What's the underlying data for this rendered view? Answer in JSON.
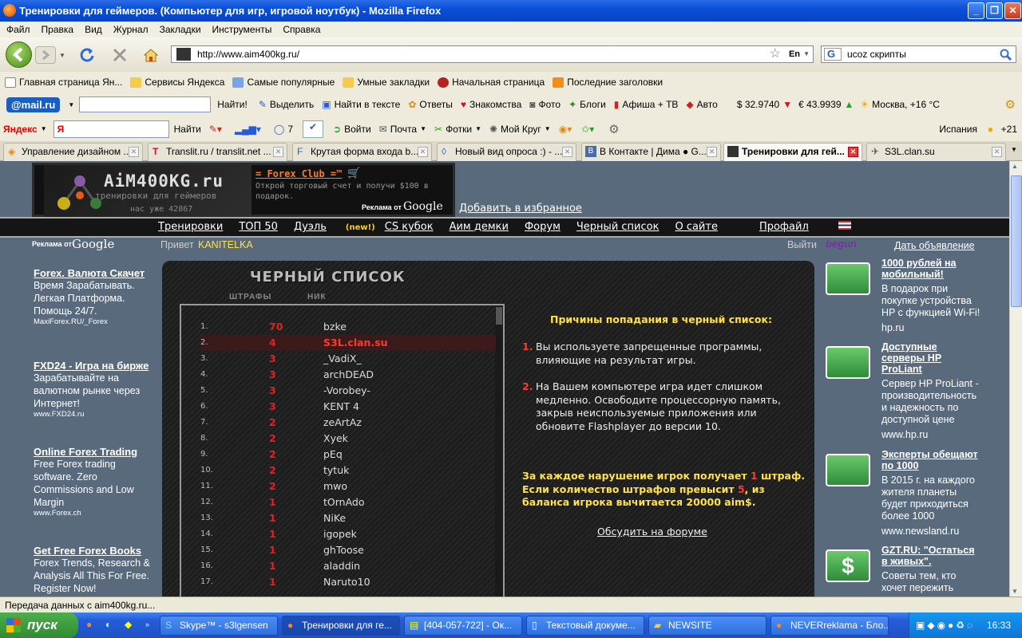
{
  "window": {
    "title": "Тренировки для геймеров. (Компьютер для игр, игровой ноутбук) - Mozilla Firefox"
  },
  "menu": [
    "Файл",
    "Правка",
    "Вид",
    "Журнал",
    "Закладки",
    "Инструменты",
    "Справка"
  ],
  "nav": {
    "url": "http://www.aim400kg.ru/",
    "lang": "En",
    "search_value": "ucoz скрипты"
  },
  "bookmarks": [
    "Главная страница Ян...",
    "Сервисы Яндекса",
    "Самые популярные",
    "Умные закладки",
    "Начальная страница",
    "Последние заголовки"
  ],
  "mailbar": {
    "brand": "@mail.ru",
    "find_btn": "Найти!",
    "items": [
      "Выделить",
      "Найти в тексте",
      "Ответы",
      "Знакомства",
      "Фото",
      "Блоги",
      "Афиша + ТВ",
      "Авто"
    ],
    "usd": "$ 32.9740",
    "eur": "€ 43.9939",
    "weather": "Москва, +16 °C"
  },
  "yandexbar": {
    "brand": "Яндекс",
    "find_btn": "Найти",
    "count": "7",
    "items": [
      "Войти",
      "Почта",
      "Фотки",
      "Мой Круг"
    ],
    "region": "Испания",
    "temp": "+21"
  },
  "tabs": [
    {
      "label": "Управление дизайном ...",
      "active": false
    },
    {
      "label": "Translit.ru / translit.net ...",
      "active": false
    },
    {
      "label": "Крутая форма входа b...",
      "active": false
    },
    {
      "label": "Новый вид опроса :) - ...",
      "active": false
    },
    {
      "label": "В Контакте | Дима ● G...",
      "active": false
    },
    {
      "label": "Тренировки для гей...",
      "active": true
    },
    {
      "label": "S3L.clan.su",
      "active": false
    }
  ],
  "site": {
    "logo_text": "AiM400KG.ru",
    "logo_sub": "тренировки для геймеров",
    "logo_count": "нас уже 42867",
    "banner_title": "= Forex Club =™",
    "banner_text": "Открой торговый счет и получи $100 в подарок.",
    "ads_by": "Реклама от",
    "google": "Google",
    "add_fav": "Добавить в избранное",
    "navlinks": [
      "Тренировки",
      "ТОП 50",
      "Дуэль",
      "CS кубок",
      "Аим демки",
      "Форум",
      "Черный список",
      "О сайте",
      "Профайл"
    ],
    "new_badge": "(new!)",
    "hello": "Привет",
    "user": "KANITELKA",
    "logout": "Выйти",
    "begun": "begun",
    "post_ad": "Дать объявление"
  },
  "left_ads": [
    {
      "title": "Forex. Валюта Скачет",
      "text": "Время Зарабатывать. Легкая Платформа. Помощь 24/7.",
      "url": "MaxiForex.RU/_Forex"
    },
    {
      "title": "FXD24 - Игра на бирже",
      "text": "Зарабатывайте на валютном рынке через Интернет!",
      "url": "www.FXD24.ru"
    },
    {
      "title": "Online Forex Trading",
      "text": "Free Forex trading software. Zero Commissions and Low Margin",
      "url": "www.Forex.ch"
    },
    {
      "title": "Get Free Forex Books",
      "text": "Forex Trends, Research & Analysis All This For Free. Register Now!",
      "url": ""
    }
  ],
  "blacklist": {
    "title": "ЧЕРНЫЙ СПИСОК",
    "col_fines": "ШТРАФЫ",
    "col_nick": "НИК",
    "rows": [
      {
        "n": "1.",
        "fines": "70",
        "nick": "bzke"
      },
      {
        "n": "2.",
        "fines": "4",
        "nick": "S3L.clan.su"
      },
      {
        "n": "3.",
        "fines": "3",
        "nick": "_VadiX_"
      },
      {
        "n": "4.",
        "fines": "3",
        "nick": "archDEAD"
      },
      {
        "n": "5.",
        "fines": "3",
        "nick": "-Vorobey-"
      },
      {
        "n": "6.",
        "fines": "3",
        "nick": "KENT 4"
      },
      {
        "n": "7.",
        "fines": "2",
        "nick": "zeArtAz"
      },
      {
        "n": "8.",
        "fines": "2",
        "nick": "Xyek"
      },
      {
        "n": "9.",
        "fines": "2",
        "nick": "pEq"
      },
      {
        "n": "10.",
        "fines": "2",
        "nick": "tytuk"
      },
      {
        "n": "11.",
        "fines": "2",
        "nick": "mwo"
      },
      {
        "n": "12.",
        "fines": "1",
        "nick": "tOrnAdo"
      },
      {
        "n": "13.",
        "fines": "1",
        "nick": "NiKe"
      },
      {
        "n": "14.",
        "fines": "1",
        "nick": "igopek"
      },
      {
        "n": "15.",
        "fines": "1",
        "nick": "ghToose"
      },
      {
        "n": "16.",
        "fines": "1",
        "nick": "aladdin"
      },
      {
        "n": "17.",
        "fines": "1",
        "nick": "Naruto10"
      }
    ],
    "reasons_title": "Причины попадания в черный список:",
    "reason1_num": "1.",
    "reason1": "Вы используете запрещенные программы, влияющие на результат игры.",
    "reason2_num": "2.",
    "reason2": "На Вашем компьютере игра идет слишком медленно. Освободите процессорную память, закрыв  неиспользуемые приложения или обновите Flashplayer до версии 10.",
    "penalty_a": "За каждое нарушение игрок получает",
    "penalty_one": "1",
    "penalty_b": "штраф.",
    "penalty_c": "Если количество штрафов превысит",
    "penalty_five": "5",
    "penalty_d": ", из баланса игрока вычитается 20000 aim$.",
    "forum_link": "Обсудить на форуме"
  },
  "right_ads": [
    {
      "title": "1000 рублей на мобильный!",
      "text": "В подарок при покупке устройства HP с функцией Wi-Fi!",
      "url": "hp.ru"
    },
    {
      "title": "Доступные серверы HP ProLiant",
      "text": "Сервер HP ProLiant - производительность и надежность по доступной цене",
      "url": "www.hp.ru"
    },
    {
      "title": "Эксперты обещают по 1000",
      "text": "В 2015 г. на каждого жителя планеты будет приходиться более 1000",
      "url": "www.newsland.ru"
    },
    {
      "title": "GZT.RU: \"Остаться в живых\".",
      "text": "Советы тем, кто хочет пережить",
      "url": ""
    }
  ],
  "status": "Передача данных с aim400kg.ru...",
  "taskbar": {
    "start": "пуск",
    "tasks": [
      "Skype™ - s3lgensen",
      "Тренировки для ге...",
      "[404-057-722] - Ок...",
      "Текстовый докуме...",
      "NEWSITE",
      "NEVERreklama - Бло..."
    ],
    "clock": "16:33"
  }
}
